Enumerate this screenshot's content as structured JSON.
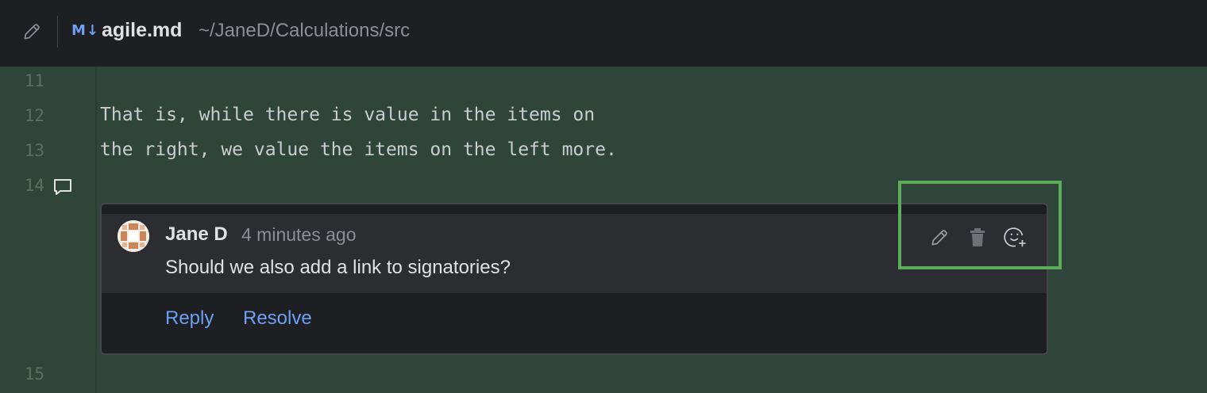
{
  "header": {
    "edit_icon": "pencil-icon",
    "file_type_badge": "M↓",
    "file_name": "agile.md",
    "file_path": "~/JaneD/Calculations/src"
  },
  "editor": {
    "background": "#2f4539",
    "lines": [
      {
        "number": "11",
        "text": ""
      },
      {
        "number": "12",
        "text": "That is, while there is value in the items on"
      },
      {
        "number": "13",
        "text": "the right, we value the items on the left more."
      },
      {
        "number": "14",
        "text": ""
      },
      {
        "number": "15",
        "text": ""
      }
    ],
    "gutter_comment_icon": "comment-icon"
  },
  "comment": {
    "author": "Jane D",
    "time": "4 minutes ago",
    "text": "Should we also add a link to signatories?",
    "actions": {
      "edit_icon": "pencil-icon",
      "delete_icon": "trash-icon",
      "reaction_icon": "add-reaction-icon"
    },
    "reply_label": "Reply",
    "resolve_label": "Resolve"
  },
  "colors": {
    "link": "#6e9ff5",
    "highlight": "#5cac5a"
  }
}
